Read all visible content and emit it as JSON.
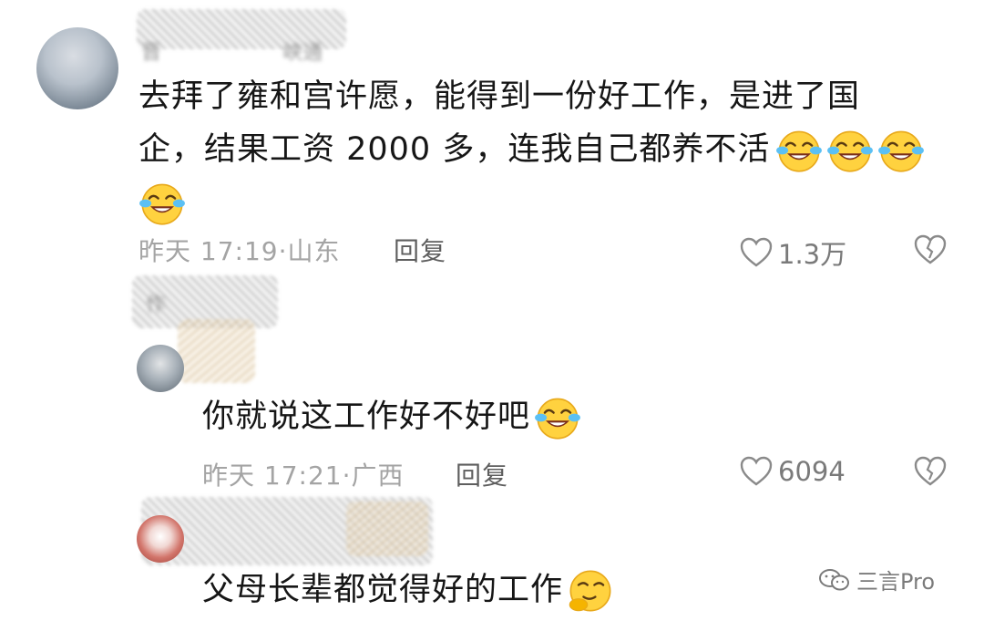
{
  "comments": [
    {
      "username": "晋",
      "username_tail": "峡通",
      "text_line1": "去拜了雍和宫许愿，能得到一份好工作，是进了国",
      "text_line2": "企，结果工资 2000 多，连我自己都养不活",
      "time": "昨天 17:19·",
      "location": "山东",
      "reply_label": "回复",
      "likes": "1.3万",
      "emojis": [
        "crying-laughing",
        "crying-laughing",
        "crying-laughing",
        "crying-laughing"
      ]
    },
    {
      "username": "作",
      "username_tail": "",
      "text": "你就说这工作好不好吧",
      "time": "昨天 17:21·",
      "location": "广西",
      "reply_label": "回复",
      "likes": "6094",
      "emojis": [
        "crying-laughing"
      ]
    },
    {
      "username": "",
      "text": "父母长辈都觉得好的工作",
      "emojis": [
        "smirk-hand"
      ]
    }
  ],
  "watermark": {
    "text": "三言Pro",
    "icon": "wechat-icon"
  },
  "colors": {
    "meta_gray": "#a4a4a4",
    "reply_gray": "#5e5e5e",
    "emoji_yellow": "#ffd23f"
  }
}
